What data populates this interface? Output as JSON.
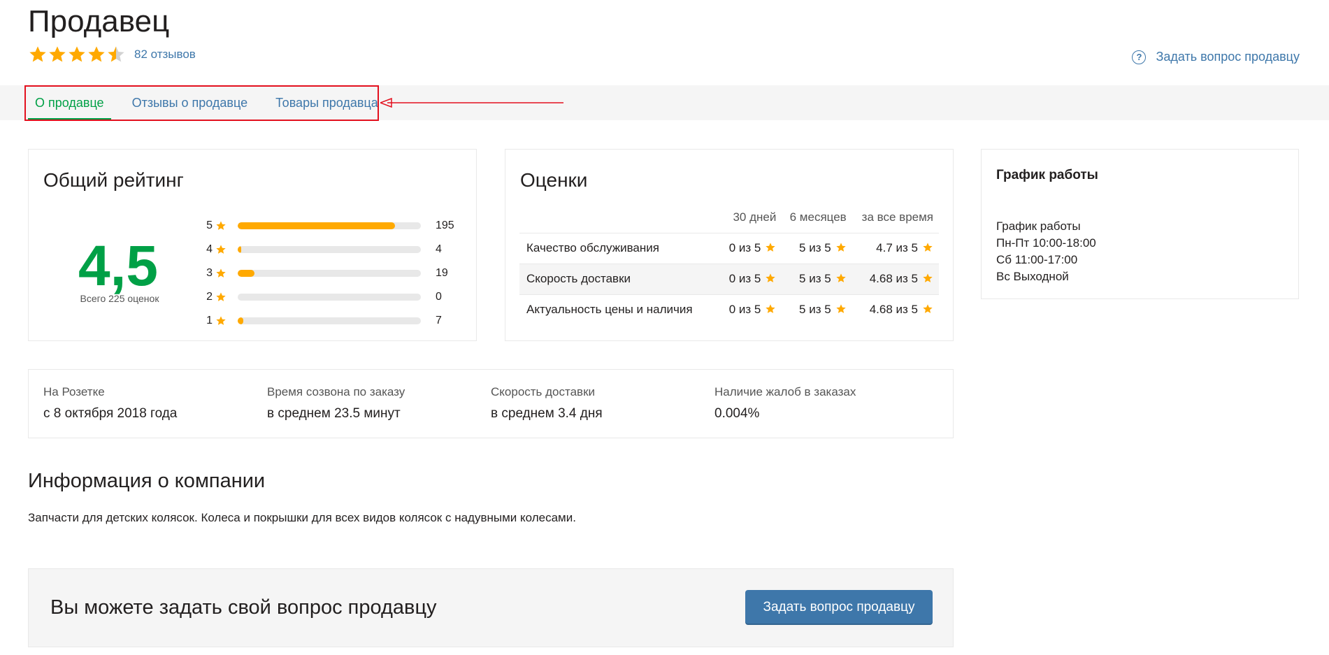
{
  "header": {
    "title": "Продавец",
    "rating_value": 4.5,
    "reviews_link": "82 отзывов",
    "ask_link": "Задать вопрос продавцу",
    "ask_icon": "question-circle-icon"
  },
  "tabs": [
    {
      "label": "О продавце",
      "active": true
    },
    {
      "label": "Отзывы о продавце",
      "active": false
    },
    {
      "label": "Товары продавца",
      "active": false
    }
  ],
  "overall": {
    "title": "Общий рейтинг",
    "score": "4,5",
    "caption": "Всего 225 оценок",
    "distribution": [
      {
        "stars": "5",
        "count": "195",
        "fraction": 0.86
      },
      {
        "stars": "4",
        "count": "4",
        "fraction": 0.02
      },
      {
        "stars": "3",
        "count": "19",
        "fraction": 0.09
      },
      {
        "stars": "2",
        "count": "0",
        "fraction": 0.0
      },
      {
        "stars": "1",
        "count": "7",
        "fraction": 0.03
      }
    ]
  },
  "grades": {
    "title": "Оценки",
    "columns": [
      "30 дней",
      "6 месяцев",
      "за все время"
    ],
    "rows": [
      {
        "name": "Качество обслуживания",
        "d30": "0 из 5",
        "m6": "5 из 5",
        "all": "4.7 из 5"
      },
      {
        "name": "Скорость доставки",
        "d30": "0 из 5",
        "m6": "5 из 5",
        "all": "4.68 из 5"
      },
      {
        "name": "Актуальность цены и наличия",
        "d30": "0 из 5",
        "m6": "5 из 5",
        "all": "4.68 из 5"
      }
    ]
  },
  "schedule": {
    "title": "График работы",
    "lines": [
      "График работы",
      "Пн-Пт 10:00-18:00",
      "Сб 11:00-17:00",
      "Вс Выходной"
    ]
  },
  "stats": [
    {
      "label": "На Розетке",
      "value": "с 8 октября 2018 года"
    },
    {
      "label": "Время созвона по заказу",
      "value": "в среднем 23.5 минут"
    },
    {
      "label": "Скорость доставки",
      "value": "в среднем 3.4 дня"
    },
    {
      "label": "Наличие жалоб в заказах",
      "value": "0.004%"
    }
  ],
  "company": {
    "title": "Информация о компании",
    "text": "Запчасти для детских колясок. Колеса и покрышки для всех видов колясок с надувными колесами."
  },
  "ask_panel": {
    "text": "Вы можете задать свой вопрос продавцу",
    "button": "Задать вопрос продавцу"
  },
  "colors": {
    "accent_green": "#00a046",
    "link_blue": "#3e77aa",
    "star_yellow": "#ffa900",
    "highlight_red": "#e3101e"
  }
}
